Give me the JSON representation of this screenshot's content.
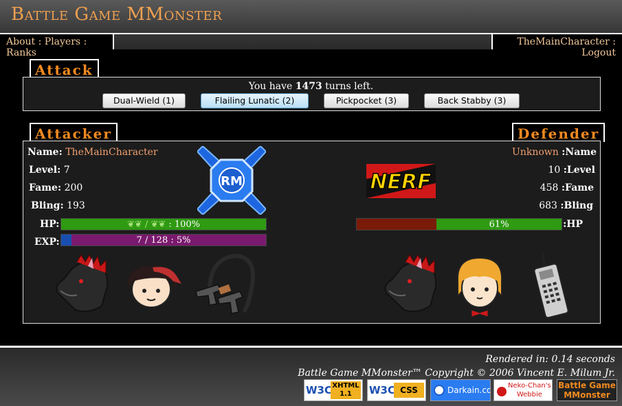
{
  "header": {
    "site_title": "Battle Game MMonster",
    "nav_left": [
      "About",
      "Players",
      "Ranks"
    ],
    "nav_sep": ":",
    "nav_right": [
      "TheMainCharacter",
      "Logout"
    ]
  },
  "attack": {
    "tab_label": "Attack",
    "turns_prefix": "You have ",
    "turns_count": "1473",
    "turns_suffix": " turns left.",
    "buttons": [
      {
        "label": "Dual-Wield (1)",
        "active": false
      },
      {
        "label": "Flailing Lunatic (2)",
        "active": true
      },
      {
        "label": "Pickpocket (3)",
        "active": false
      },
      {
        "label": "Back Stabby (3)",
        "active": false
      }
    ]
  },
  "attacker": {
    "tab_label": "Attacker",
    "name_label": "Name:",
    "name": "TheMainCharacter",
    "level_label": "Level:",
    "level": "7",
    "fame_label": "Fame:",
    "fame": "200",
    "bling_label": "Bling:",
    "bling": "193",
    "hp_label": "HP:",
    "hp_text": ": 100%",
    "hp_percent": 100,
    "exp_label": "EXP:",
    "exp_text": "7 / 128 : 5%",
    "exp_percent": 5,
    "avatar_icon": "rm-logo-icon",
    "items": [
      "dark-horse-icon",
      "bandana-kid-icon",
      "handcuffs-pistol-icon"
    ]
  },
  "defender": {
    "tab_label": "Defender",
    "name_label": ":Name",
    "name": "Unknown",
    "level_label": ":Level",
    "level": "10",
    "fame_label": ":Fame",
    "fame": "458",
    "bling_label": ":Bling",
    "bling": "683",
    "hp_label": ":HP",
    "hp_text": "61%",
    "hp_percent": 61,
    "avatar_text": "NERF",
    "items": [
      "dark-horse-icon",
      "blonde-kid-icon",
      "cell-phone-icon"
    ]
  },
  "footer": {
    "rendered": "Rendered in: 0.14 seconds",
    "copyright": "Battle Game MMonster™ Copyright © 2006 Vincent E. Milum Jr.",
    "badges": [
      {
        "text1": "W3C",
        "text2": "XHTML 1.1"
      },
      {
        "text1": "W3C",
        "text2": "CSS"
      },
      {
        "text1": "Darkain.com"
      },
      {
        "text1": "Neko-Chan's",
        "text2": "Webbie"
      },
      {
        "text1": "Battle Game",
        "text2": "MMonster"
      }
    ]
  },
  "colors": {
    "accent": "#f08a20",
    "hp_green": "#2f9a12",
    "hp_red": "#7a1a08",
    "exp_purple": "#7a1a6e",
    "exp_blue": "#1a4fb0"
  }
}
